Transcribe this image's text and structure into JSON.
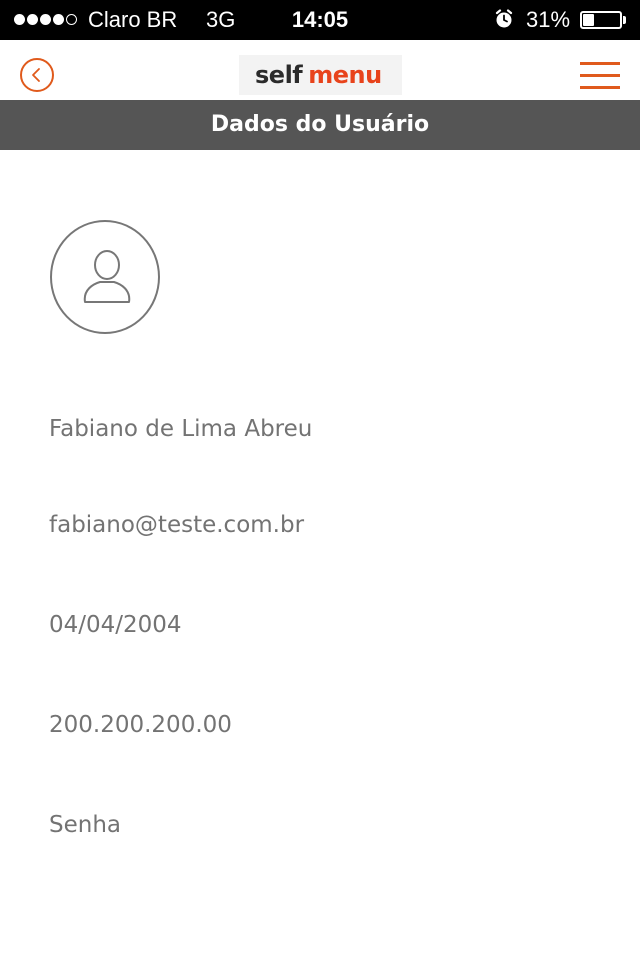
{
  "status_bar": {
    "carrier": "Claro BR",
    "network": "3G",
    "time": "14:05",
    "battery_percent": "31%",
    "battery_level": 0.31,
    "signal_bars_filled": 4,
    "signal_bars_total": 5,
    "icons": [
      "signal-dots-icon",
      "alarm-icon",
      "battery-icon"
    ]
  },
  "nav": {
    "logo_self": "self",
    "logo_menu": "menu",
    "icons": [
      "back-arrow-icon",
      "hamburger-menu-icon"
    ],
    "accent_color": "#e05a1c"
  },
  "header": {
    "title": "Dados do Usuário",
    "background_color": "#555555"
  },
  "profile": {
    "avatar_icon": "user-icon",
    "name": "Fabiano de Lima Abreu",
    "email": "fabiano@teste.com.br",
    "birth_date": "04/04/2004",
    "document": "200.200.200.00",
    "password_placeholder": "Senha"
  }
}
